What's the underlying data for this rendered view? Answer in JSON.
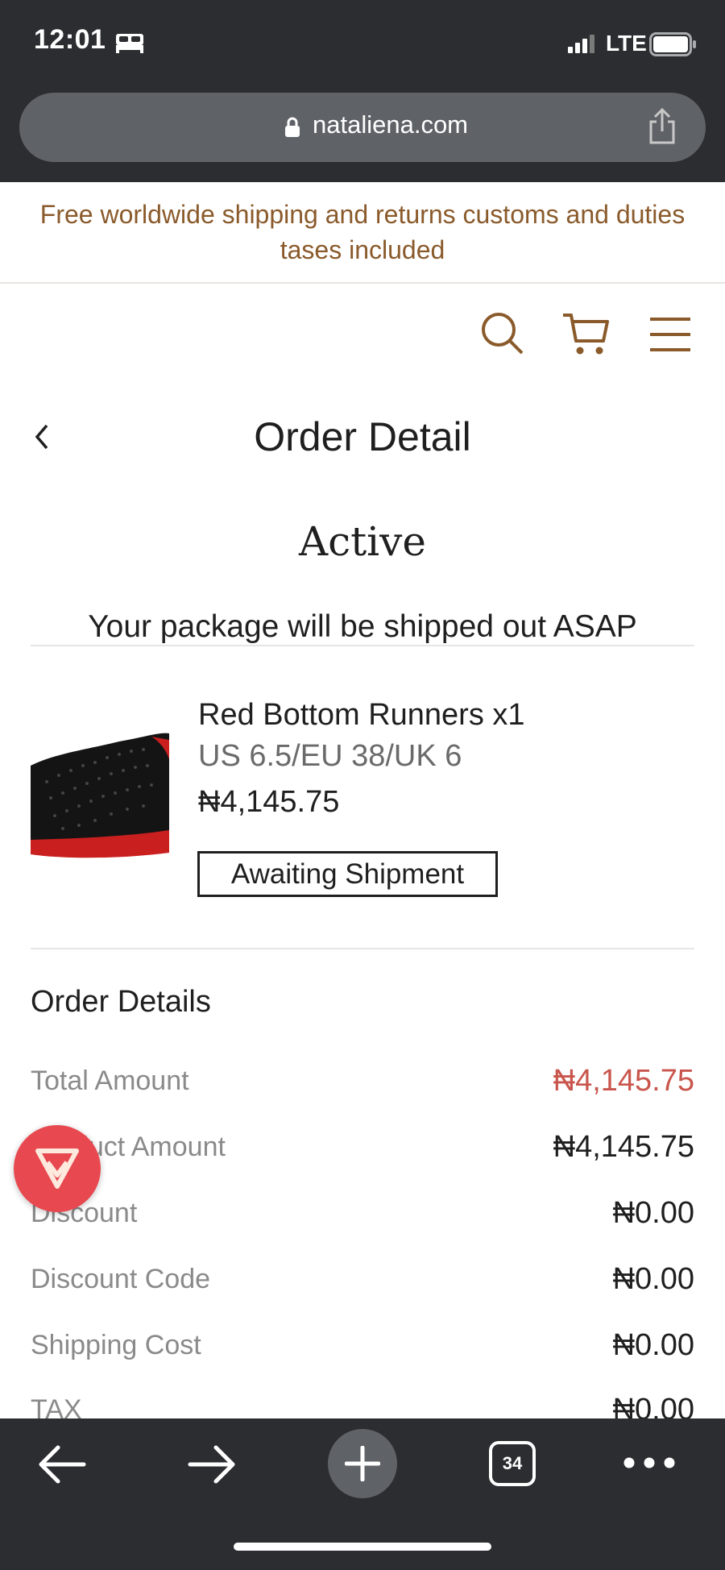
{
  "status_bar": {
    "time": "12:01",
    "network": "LTE"
  },
  "browser": {
    "url": "nataliena.com",
    "open_tabs": "34"
  },
  "announcement": {
    "text": "Free worldwide shipping and returns customs and duties tases included"
  },
  "header": {
    "icons": [
      "search-icon",
      "cart-icon",
      "menu-icon"
    ]
  },
  "page": {
    "title": "Order Detail"
  },
  "order": {
    "status": "Active",
    "status_message": "Your package will be shipped out ASAP",
    "item": {
      "name": "Red Bottom Runners x1",
      "variant": "US 6.5/EU 38/UK 6",
      "price": "₦4,145.75",
      "shipment_status": "Awaiting Shipment"
    }
  },
  "order_details": {
    "title": "Order Details",
    "rows": [
      {
        "label": "Total Amount",
        "value": "₦4,145.75"
      },
      {
        "label": "Product Amount",
        "value": "₦4,145.75"
      },
      {
        "label": "Discount",
        "value": "₦0.00"
      },
      {
        "label": "Discount Code",
        "value": "₦0.00"
      },
      {
        "label": "Shipping Cost",
        "value": "₦0.00"
      },
      {
        "label": "TAX",
        "value": "₦0.00"
      }
    ]
  },
  "colors": {
    "accent_price": "#c9564d",
    "brand_brown": "#8a5a2b",
    "fab": "#e8484f",
    "chrome": "#2c2d30"
  }
}
